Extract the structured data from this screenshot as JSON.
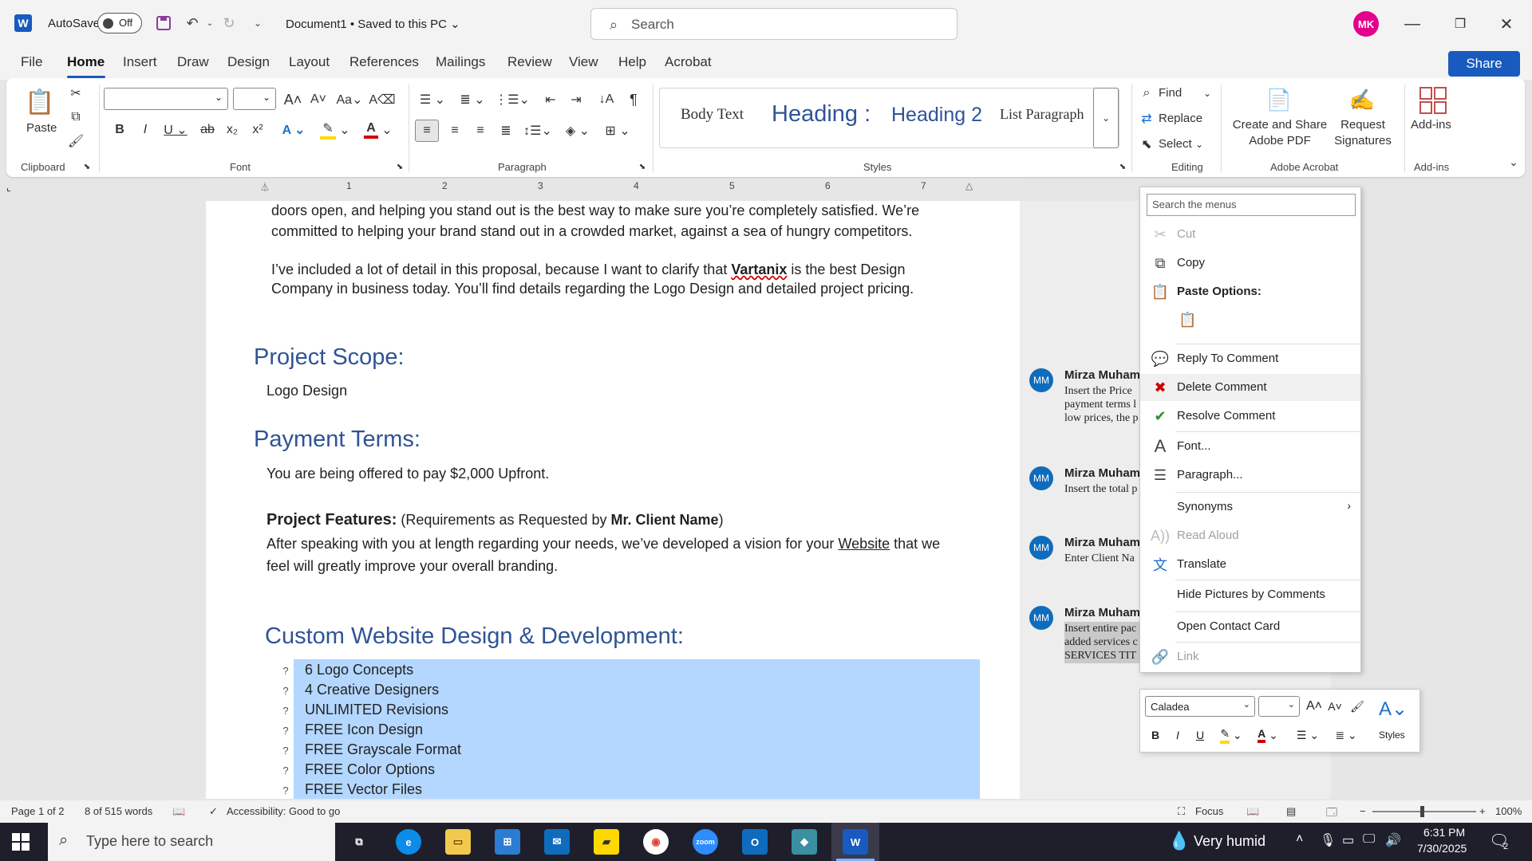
{
  "titlebar": {
    "autosave_label": "AutoSave",
    "autosave_state": "Off",
    "doc_title": "Document1 • Saved to this PC ⌄",
    "search_placeholder": "Search",
    "avatar_initials": "MK"
  },
  "tabs": [
    "File",
    "Home",
    "Insert",
    "Draw",
    "Design",
    "Layout",
    "References",
    "Mailings",
    "Review",
    "View",
    "Help",
    "Acrobat"
  ],
  "share_label": "Share",
  "ribbon": {
    "paste_label": "Paste",
    "clipboard_label": "Clipboard",
    "font_label": "Font",
    "paragraph_label": "Paragraph",
    "styles_label": "Styles",
    "editing_label": "Editing",
    "acrobat_label": "Adobe Acrobat",
    "addins_label": "Add-ins",
    "styles": [
      "Body Text",
      "Heading :",
      "Heading 2",
      "List Paragraph"
    ],
    "find_label": "Find",
    "replace_label": "Replace",
    "select_label": "Select",
    "create_share_label_1": "Create and Share",
    "create_share_label_2": "Adobe PDF",
    "request_sig_label_1": "Request",
    "request_sig_label_2": "Signatures",
    "addins_button": "Add-ins"
  },
  "ruler_numbers": [
    "1",
    "2",
    "3",
    "4",
    "5",
    "6",
    "7"
  ],
  "document": {
    "p1_line1": "doors open, and helping you stand out is the best way to make sure you’re completely satisfied. We’re",
    "p1_line2": "committed to helping your brand stand out in a crowded market, against a sea of hungry competitors.",
    "p2_line1_a": "I’ve included a lot of detail in this proposal, because I want to clarify that ",
    "p2_line1_b": "Vartanix",
    "p2_line1_c": " is the best Design",
    "p2_line2": "Company in business today. You’ll find details regarding the Logo Design and detailed project pricing.",
    "h_scope": "Project Scope:",
    "scope_text": "Logo Design",
    "h_payment": "Payment Terms:",
    "payment_text": "You are being offered to pay $2,000 Upfront.",
    "features_bold": "Project Features:",
    "features_rest_a": " (Requirements as Requested by ",
    "features_client": "Mr. Client Name",
    "features_rest_b": ")",
    "vision_line1_a": "After speaking with you at length regarding your needs, we’ve developed a vision for your ",
    "vision_link": "Website",
    "vision_line1_b": " that we",
    "vision_line2": "feel will greatly improve your overall branding.",
    "h_custom": "Custom Website Design & Development:",
    "bullet_mark": "?",
    "bullets": [
      "6 Logo Concepts",
      "4 Creative Designers",
      "UNLIMITED Revisions",
      "FREE Icon Design",
      "FREE Grayscale Format",
      "FREE Color Options",
      "FREE Vector Files"
    ]
  },
  "comments": [
    {
      "initials": "MM",
      "author": "Mirza Muham",
      "body": "Insert the Price payment terms l low prices, the p"
    },
    {
      "initials": "MM",
      "author": "Mirza Muham",
      "body": "Insert the total p"
    },
    {
      "initials": "MM",
      "author": "Mirza Muham",
      "body": "Enter Client Na"
    },
    {
      "initials": "MM",
      "author": "Mirza Muham",
      "body": "Insert entire pac added services c SERVICES TIT"
    }
  ],
  "context_menu": {
    "search_placeholder": "Search the menus",
    "cut": "Cut",
    "copy": "Copy",
    "paste_options": "Paste Options:",
    "reply": "Reply To Comment",
    "delete": "Delete Comment",
    "resolve": "Resolve Comment",
    "font": "Font...",
    "paragraph": "Paragraph...",
    "synonyms": "Synonyms",
    "read_aloud": "Read Aloud",
    "translate": "Translate",
    "hide_pictures": "Hide Pictures by Comments",
    "open_contact": "Open Contact Card",
    "link": "Link"
  },
  "mini_toolbar": {
    "font_name": "Caladea",
    "styles_label": "Styles"
  },
  "statusbar": {
    "page": "Page 1 of 2",
    "words": "8 of 515 words",
    "accessibility": "Accessibility: Good to go",
    "focus": "Focus",
    "zoom": "100%"
  },
  "taskbar": {
    "search_placeholder": "Type here to search",
    "weather": "Very humid",
    "time": "6:31 PM",
    "date": "7/30/2025",
    "notification_count": "2"
  },
  "colors": {
    "accent": "#185abd",
    "heading": "#2f5496",
    "selection": "#b4d7ff",
    "avatar_mk": "#e3008c",
    "comment_avatar": "#0f6cbd"
  }
}
